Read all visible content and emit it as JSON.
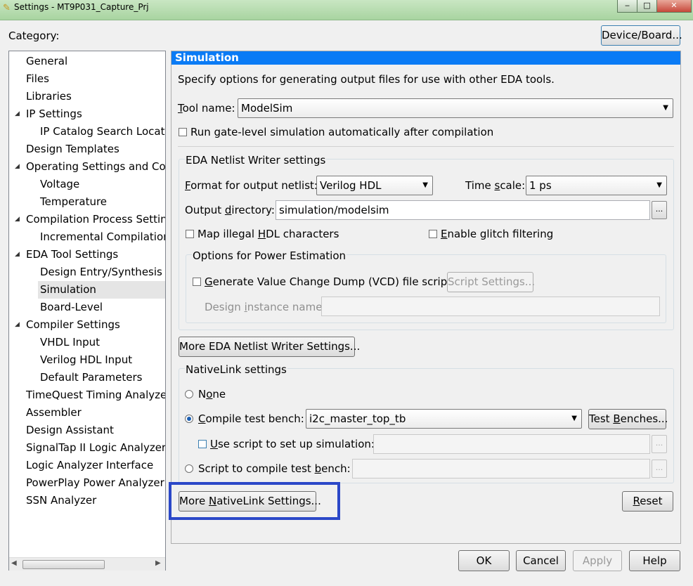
{
  "window": {
    "title": "Settings - MT9P031_Capture_Prj",
    "minimize": "‒",
    "maximize": "□",
    "close": "✕"
  },
  "category_label": "Category:",
  "device_button": "Device/Board...",
  "tree": [
    {
      "label": "General",
      "level": 0,
      "expander": false
    },
    {
      "label": "Files",
      "level": 0,
      "expander": false
    },
    {
      "label": "Libraries",
      "level": 0,
      "expander": false
    },
    {
      "label": "IP Settings",
      "level": 0,
      "expander": true
    },
    {
      "label": "IP Catalog Search Locatio",
      "level": 1,
      "expander": false
    },
    {
      "label": "Design Templates",
      "level": 0,
      "expander": false
    },
    {
      "label": "Operating Settings and Con",
      "level": 0,
      "expander": true
    },
    {
      "label": "Voltage",
      "level": 1,
      "expander": false
    },
    {
      "label": "Temperature",
      "level": 1,
      "expander": false
    },
    {
      "label": "Compilation Process Setting",
      "level": 0,
      "expander": true
    },
    {
      "label": "Incremental Compilation",
      "level": 1,
      "expander": false
    },
    {
      "label": "EDA Tool Settings",
      "level": 0,
      "expander": true
    },
    {
      "label": "Design Entry/Synthesis",
      "level": 1,
      "expander": false
    },
    {
      "label": "Simulation",
      "level": 1,
      "expander": false,
      "selected": true
    },
    {
      "label": "Board-Level",
      "level": 1,
      "expander": false
    },
    {
      "label": "Compiler Settings",
      "level": 0,
      "expander": true
    },
    {
      "label": "VHDL Input",
      "level": 1,
      "expander": false
    },
    {
      "label": "Verilog HDL Input",
      "level": 1,
      "expander": false
    },
    {
      "label": "Default Parameters",
      "level": 1,
      "expander": false
    },
    {
      "label": "TimeQuest Timing Analyzer",
      "level": 0,
      "expander": false
    },
    {
      "label": "Assembler",
      "level": 0,
      "expander": false
    },
    {
      "label": "Design Assistant",
      "level": 0,
      "expander": false
    },
    {
      "label": "SignalTap II Logic Analyzer",
      "level": 0,
      "expander": false
    },
    {
      "label": "Logic Analyzer Interface",
      "level": 0,
      "expander": false
    },
    {
      "label": "PowerPlay Power Analyzer S",
      "level": 0,
      "expander": false
    },
    {
      "label": "SSN Analyzer",
      "level": 0,
      "expander": false
    }
  ],
  "panel": {
    "header": "Simulation",
    "description": "Specify options for generating output files for use with other EDA tools.",
    "tool_name_label": "Tool name:",
    "tool_name_value": "ModelSim",
    "run_gate_level_label": "Run gate-level simulation automatically after compilation",
    "netlist_group_title": "EDA Netlist Writer settings",
    "format_label": "Format for output netlist:",
    "format_value": "Verilog HDL",
    "time_scale_label": "Time scale:",
    "time_scale_value": "1 ps",
    "output_dir_label": "Output directory:",
    "output_dir_value": "simulation/modelsim",
    "browse": "...",
    "map_illegal_label": "Map illegal HDL characters",
    "glitch_label": "Enable glitch filtering",
    "power_group_title": "Options for Power Estimation",
    "vcd_label": "Generate Value Change Dump (VCD) file script",
    "script_settings_button": "Script Settings...",
    "design_instance_label": "Design instance name:",
    "more_eda_button": "More EDA Netlist Writer Settings...",
    "nativelink_group_title": "NativeLink settings",
    "none_label": "None",
    "compile_tb_label": "Compile test bench:",
    "compile_tb_value": "i2c_master_top_tb",
    "test_benches_button": "Test Benches...",
    "use_script_label": "Use script to set up simulation:",
    "script_compile_label": "Script to compile test bench:",
    "more_nativelink_button": "More NativeLink Settings...",
    "reset_button": "Reset"
  },
  "footer": {
    "ok": "OK",
    "cancel": "Cancel",
    "apply": "Apply",
    "help": "Help"
  },
  "colors": {
    "header_bg": "#0a7bf5",
    "highlight_box": "#2b48c8",
    "titlebar": "#a8d4a0"
  },
  "icons": {
    "tree_expander": "triangle-expanded-icon",
    "combo_arrow": "dropdown-arrow-icon"
  }
}
